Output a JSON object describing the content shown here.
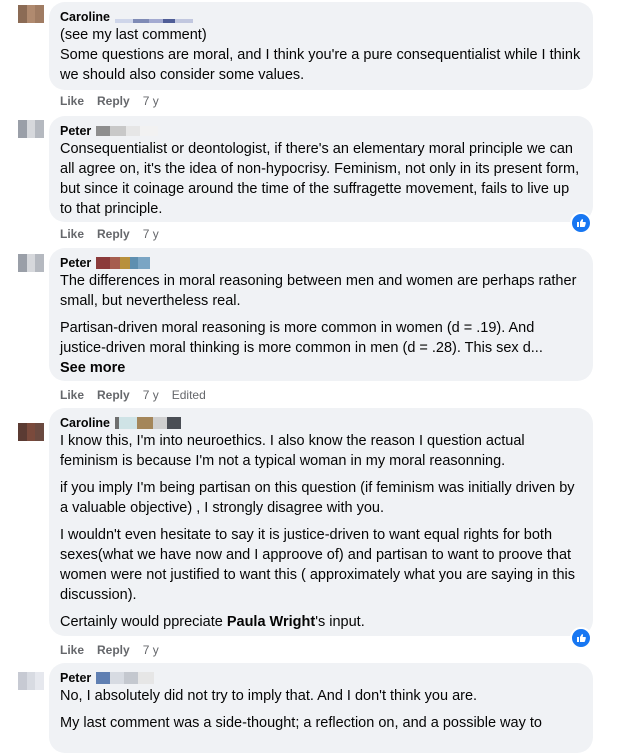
{
  "comments": [
    {
      "author": "Caroline",
      "lines": [
        "(see my last comment)",
        "Some questions are moral, and I think you're a pure consequentialist while I think we should also consider some values."
      ],
      "actions": {
        "like": "Like",
        "reply": "Reply",
        "time": "7 y"
      }
    },
    {
      "author": "Peter",
      "lines": [
        "Consequentialist or deontologist, if there's an elementary moral principle we can all agree on, it's the idea of non-hypocrisy. Feminism, not only in its present form, but since it coinage around the time of the suffragette movement, fails to live up to that principle."
      ],
      "actions": {
        "like": "Like",
        "reply": "Reply",
        "time": "7 y"
      }
    },
    {
      "author": "Peter",
      "paragraphs": [
        "The differences in moral reasoning between men and women are perhaps rather small, but nevertheless real.",
        "Partisan-driven moral reasoning is more common in women (d = .19). And justice-driven moral thinking is more common in men (d = .28). This sex d..."
      ],
      "see_more": "See more",
      "actions": {
        "like": "Like",
        "reply": "Reply",
        "time": "7 y",
        "edited": "Edited"
      }
    },
    {
      "author": "Caroline",
      "paragraphs": [
        "I know this, I'm into neuroethics. I also know the reason I question actual feminism is because I'm not a typical woman in my moral reasonning.",
        "if you imply I'm being partisan on this question (if feminism was initially driven by a valuable objective) , I strongly disagree with you.",
        "I wouldn't even hesitate to say it is justice-driven to want equal rights for both sexes(what we have now and I approove of) and partisan to want to proove that women were not justified to want this ( approximately what you are saying in this discussion).",
        "Certainly would ppreciate"
      ],
      "mention": "Paula Wright",
      "mention_suffix": "'s input.",
      "actions": {
        "like": "Like",
        "reply": "Reply",
        "time": "7 y"
      }
    },
    {
      "author": "Peter",
      "paragraphs": [
        "No, I absolutely did not try to imply that. And I don't think you are.",
        "My last comment was a side-thought; a reflection on, and a possible way to"
      ]
    }
  ],
  "colors": {
    "bubble": "#f0f2f5",
    "meta": "#65676b",
    "like_blue": "#1877f2"
  },
  "icons": {
    "like_badge": "thumbs-up-icon"
  }
}
